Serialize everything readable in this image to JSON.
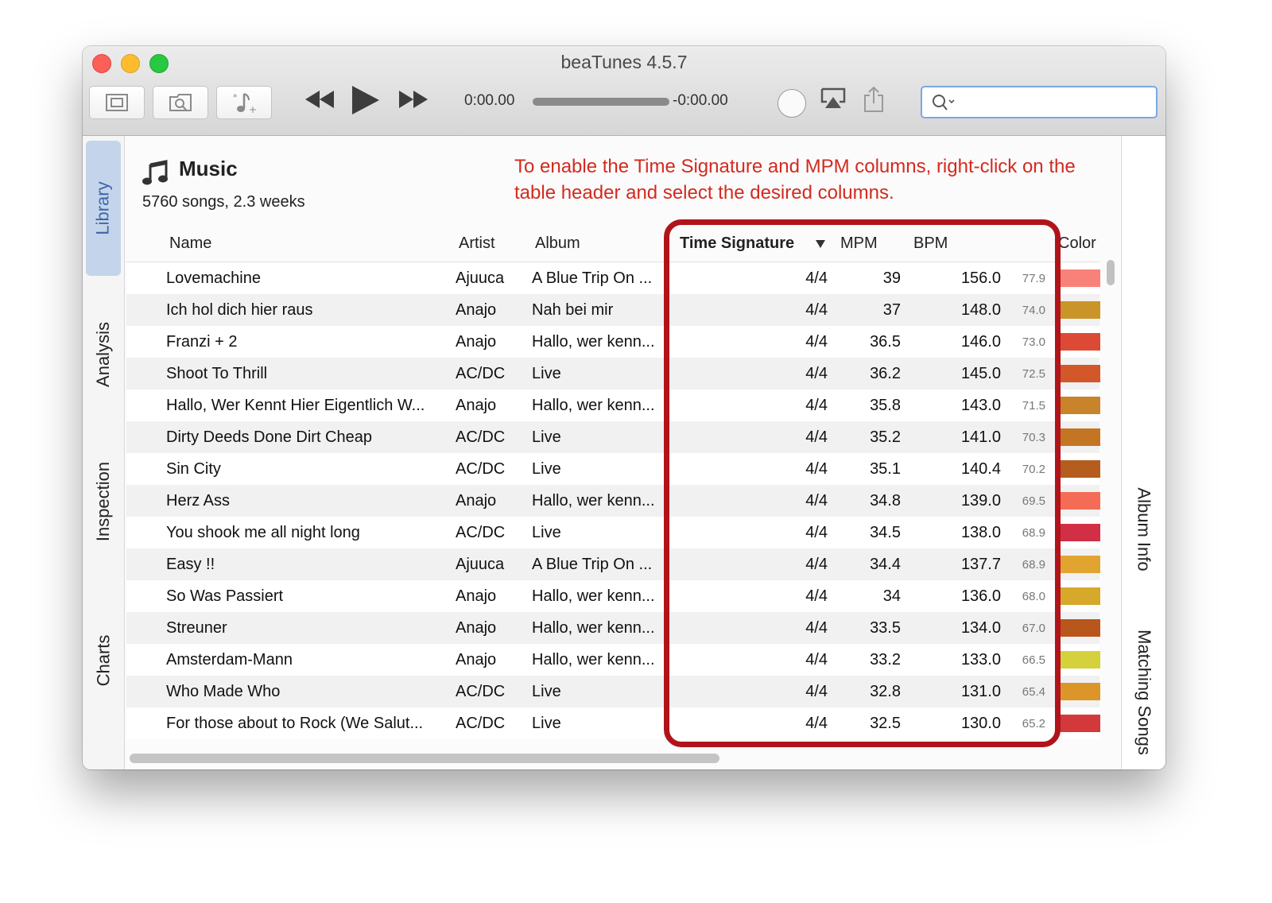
{
  "window": {
    "title": "beaTunes 4.5.7"
  },
  "toolbar": {
    "buttons": [
      {
        "name": "library-view-icon"
      },
      {
        "name": "browse-icon"
      },
      {
        "name": "analyze-icon"
      }
    ],
    "time_elapsed": "0:00.00",
    "time_remaining": "-0:00.00",
    "search_placeholder": ""
  },
  "left_tabs": [
    "Library",
    "Analysis",
    "Inspection",
    "Charts"
  ],
  "right_tabs": [
    "Album Info",
    "Matching Songs"
  ],
  "library": {
    "title": "Music",
    "subtitle": "5760 songs, 2.3 weeks"
  },
  "callout": "To enable the Time Signature and MPM columns, right-click on the table header and select the desired columns.",
  "table": {
    "headers": {
      "name": "Name",
      "artist": "Artist",
      "album": "Album",
      "time_signature": "Time Signature",
      "mpm": "MPM",
      "bpm": "BPM",
      "color": "Color"
    },
    "rows": [
      {
        "name": "Lovemachine",
        "artist": "Ajuuca",
        "album": "A Blue Trip On ...",
        "ts": "4/4",
        "mpm": "39",
        "bpm": "156.0",
        "score": "77.9",
        "color": "#f88279"
      },
      {
        "name": "Ich hol dich hier raus",
        "artist": "Anajo",
        "album": "Nah bei mir",
        "ts": "4/4",
        "mpm": "37",
        "bpm": "148.0",
        "score": "74.0",
        "color": "#c99428"
      },
      {
        "name": "Franzi + 2",
        "artist": "Anajo",
        "album": "Hallo, wer kenn...",
        "ts": "4/4",
        "mpm": "36.5",
        "bpm": "146.0",
        "score": "73.0",
        "color": "#dc4a35"
      },
      {
        "name": "Shoot To Thrill",
        "artist": "AC/DC",
        "album": "Live",
        "ts": "4/4",
        "mpm": "36.2",
        "bpm": "145.0",
        "score": "72.5",
        "color": "#d2582a"
      },
      {
        "name": "Hallo, Wer Kennt Hier Eigentlich W...",
        "artist": "Anajo",
        "album": "Hallo, wer kenn...",
        "ts": "4/4",
        "mpm": "35.8",
        "bpm": "143.0",
        "score": "71.5",
        "color": "#c9832a"
      },
      {
        "name": "Dirty Deeds Done Dirt Cheap",
        "artist": "AC/DC",
        "album": "Live",
        "ts": "4/4",
        "mpm": "35.2",
        "bpm": "141.0",
        "score": "70.3",
        "color": "#c47524"
      },
      {
        "name": "Sin City",
        "artist": "AC/DC",
        "album": "Live",
        "ts": "4/4",
        "mpm": "35.1",
        "bpm": "140.4",
        "score": "70.2",
        "color": "#b45d1e"
      },
      {
        "name": "Herz Ass",
        "artist": "Anajo",
        "album": "Hallo, wer kenn...",
        "ts": "4/4",
        "mpm": "34.8",
        "bpm": "139.0",
        "score": "69.5",
        "color": "#f46c55"
      },
      {
        "name": "You shook me all night long",
        "artist": "AC/DC",
        "album": "Live",
        "ts": "4/4",
        "mpm": "34.5",
        "bpm": "138.0",
        "score": "68.9",
        "color": "#d12f45"
      },
      {
        "name": "Easy !!",
        "artist": "Ajuuca",
        "album": "A Blue Trip On ...",
        "ts": "4/4",
        "mpm": "34.4",
        "bpm": "137.7",
        "score": "68.9",
        "color": "#e2a431"
      },
      {
        "name": "So Was Passiert",
        "artist": "Anajo",
        "album": "Hallo, wer kenn...",
        "ts": "4/4",
        "mpm": "34",
        "bpm": "136.0",
        "score": "68.0",
        "color": "#d6a92a"
      },
      {
        "name": "Streuner",
        "artist": "Anajo",
        "album": "Hallo, wer kenn...",
        "ts": "4/4",
        "mpm": "33.5",
        "bpm": "134.0",
        "score": "67.0",
        "color": "#b8561c"
      },
      {
        "name": "Amsterdam-Mann",
        "artist": "Anajo",
        "album": "Hallo, wer kenn...",
        "ts": "4/4",
        "mpm": "33.2",
        "bpm": "133.0",
        "score": "66.5",
        "color": "#d4d13c"
      },
      {
        "name": "Who Made Who",
        "artist": "AC/DC",
        "album": "Live",
        "ts": "4/4",
        "mpm": "32.8",
        "bpm": "131.0",
        "score": "65.4",
        "color": "#dc9529"
      },
      {
        "name": "For those about to Rock (We Salut...",
        "artist": "AC/DC",
        "album": "Live",
        "ts": "4/4",
        "mpm": "32.5",
        "bpm": "130.0",
        "score": "65.2",
        "color": "#d3393a"
      }
    ]
  }
}
